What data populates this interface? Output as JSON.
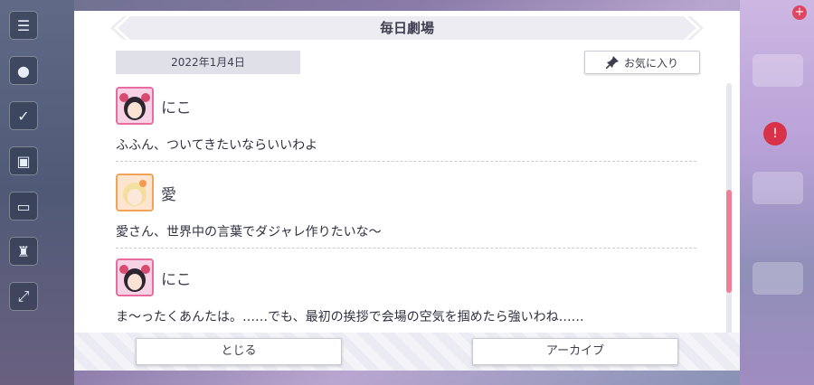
{
  "dialog": {
    "title": "毎日劇場",
    "date": "2022年1月4日",
    "favorite_label": "お気に入り"
  },
  "entries": [
    {
      "speaker": "にこ",
      "line": "ふふん、ついてきたいならいいわよ",
      "avatar_color": "#e86ca0"
    },
    {
      "speaker": "愛",
      "line": "愛さん、世界中の言葉でダジャレ作りたいな〜",
      "avatar_color": "#f2a35a"
    },
    {
      "speaker": "にこ",
      "line": "ま〜ったくあんたは。……でも、最初の挨拶で会場の空気を掴めたら強いわね……",
      "avatar_color": "#e86ca0"
    }
  ],
  "buttons": {
    "close": "とじる",
    "archive": "アーカイブ"
  },
  "colors": {
    "accent_scroll": "#f07e96",
    "title_text": "#3e3e50"
  }
}
